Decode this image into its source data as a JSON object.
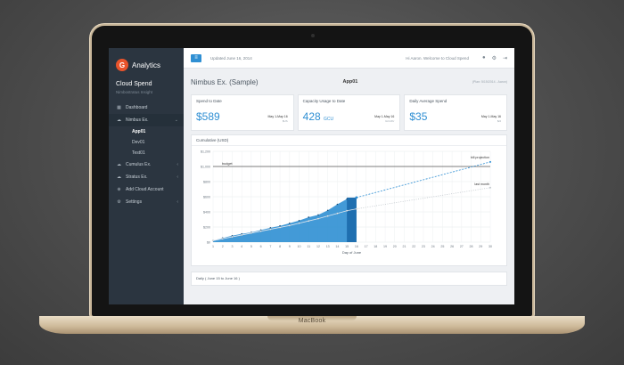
{
  "sidebar": {
    "logo_letter": "G",
    "app_name": "Analytics",
    "title": "Cloud Spend",
    "subtitle": "Nimbostratus Insight",
    "items": [
      {
        "label": "Dashboard",
        "icon": "dashboard-icon"
      },
      {
        "label": "Nimbus Ex.",
        "icon": "cloud-icon"
      },
      {
        "label": "Cumulus Ex.",
        "icon": "cloud-icon"
      },
      {
        "label": "Stratus Ex.",
        "icon": "cloud-icon"
      },
      {
        "label": "Add Cloud Account",
        "icon": "plus-circle-icon"
      },
      {
        "label": "Settings",
        "icon": "gears-icon"
      }
    ],
    "subitems": [
      "App01",
      "Dev01",
      "Test01"
    ]
  },
  "topbar": {
    "updated": "Updated June 16, 2014",
    "welcome": "Hi Aaron. Welcome to Cloud Spend",
    "icons": [
      "user-icon",
      "gear-icon",
      "sign-out-icon"
    ]
  },
  "page": {
    "title": "Nimbus Ex. (Sample)",
    "app": "App01",
    "plan": "(Plan: 5/15/2014 - Aaron)"
  },
  "cards": [
    {
      "label": "Spend to Date",
      "value": "$589",
      "unit": "",
      "range": "May 1-May 16",
      "sub": "$US"
    },
    {
      "label": "Capacity Usage to Date",
      "value": "428",
      "unit": "GCU",
      "range": "May 1-May 16",
      "sub": "GCU/hr"
    },
    {
      "label": "Daily Average Spend",
      "value": "$35",
      "unit": "",
      "range": "May 1-May 16",
      "sub": "$/d"
    }
  ],
  "chart_title": "Cumulative (USD)",
  "daily_label": "Daily ( June 15 to June 16 )",
  "chart_data": {
    "type": "area",
    "x": [
      1,
      2,
      3,
      4,
      5,
      6,
      7,
      8,
      9,
      10,
      11,
      12,
      13,
      14,
      15,
      16
    ],
    "xticks": [
      1,
      2,
      3,
      4,
      5,
      6,
      7,
      8,
      9,
      10,
      11,
      12,
      13,
      14,
      15,
      16,
      17,
      18,
      19,
      20,
      21,
      22,
      23,
      24,
      25,
      26,
      27,
      28,
      29,
      30
    ],
    "xlabel": "Day of June",
    "ylabel": "",
    "yticks": [
      "$0",
      "$200",
      "$400",
      "$600",
      "$800",
      "$1,000",
      "$1,200"
    ],
    "ylim": [
      0,
      1200
    ],
    "xlim": [
      1,
      30
    ],
    "grid": true,
    "series": [
      {
        "name": "",
        "values": [
          20,
          55,
          85,
          110,
          130,
          160,
          190,
          215,
          250,
          285,
          330,
          360,
          420,
          500,
          570,
          589
        ],
        "color": "#2f8fd3"
      },
      {
        "name": "",
        "values": [
          20,
          45,
          70,
          95,
          120,
          145,
          170,
          195,
          220,
          250,
          280,
          310,
          345,
          380,
          415,
          440
        ],
        "color": "#5a6670"
      }
    ],
    "projections": [
      {
        "label": "bill projection",
        "from_x": 16,
        "from_y": 589,
        "to_x": 30,
        "to_y": 1060,
        "color": "#2f8fd3"
      },
      {
        "label": "last month",
        "from_x": 16,
        "from_y": 440,
        "to_x": 30,
        "to_y": 720,
        "color": "#c2c8cd"
      }
    ],
    "reference": {
      "label": "budget",
      "y": 1000
    }
  }
}
